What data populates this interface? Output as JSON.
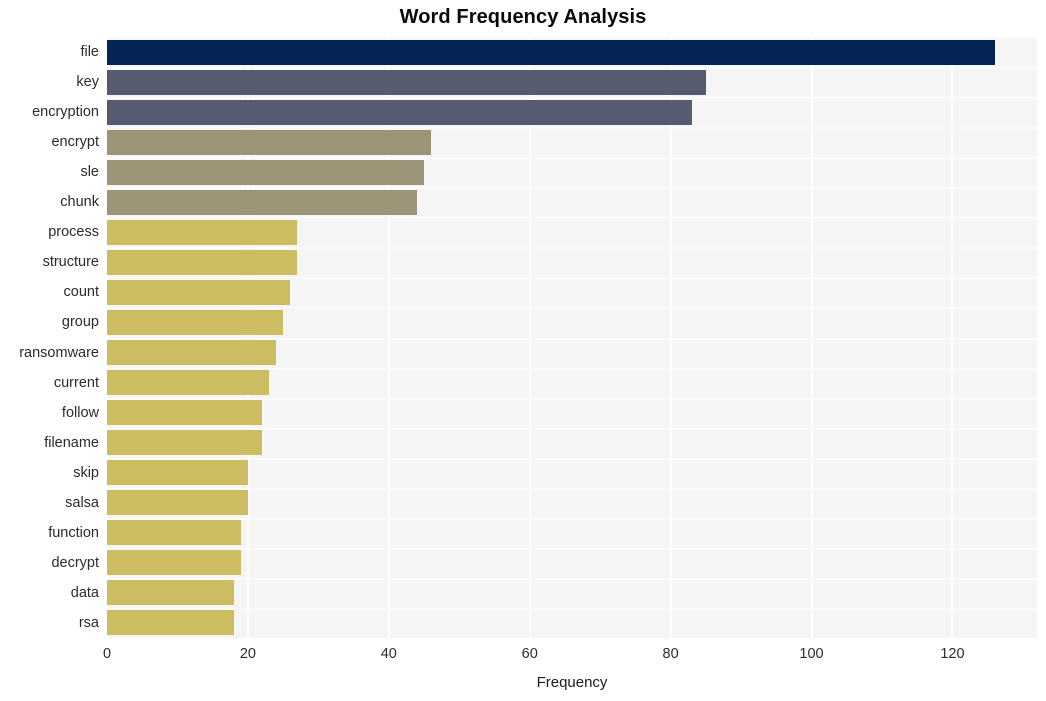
{
  "chart_data": {
    "type": "bar",
    "orientation": "horizontal",
    "title": "Word Frequency Analysis",
    "xlabel": "Frequency",
    "ylabel": "",
    "categories": [
      "file",
      "key",
      "encryption",
      "encrypt",
      "sle",
      "chunk",
      "process",
      "structure",
      "count",
      "group",
      "ransomware",
      "current",
      "follow",
      "filename",
      "skip",
      "salsa",
      "function",
      "decrypt",
      "data",
      "rsa"
    ],
    "values": [
      126,
      85,
      83,
      46,
      45,
      44,
      27,
      27,
      26,
      25,
      24,
      23,
      22,
      22,
      20,
      20,
      19,
      19,
      18,
      18
    ],
    "bar_colors": [
      "#042554",
      "#565b71",
      "#565b71",
      "#9c9476",
      "#9c9476",
      "#9c9476",
      "#ccbd62",
      "#ccbd62",
      "#ccbd62",
      "#ccbd62",
      "#ccbd62",
      "#ccbd62",
      "#ccbd62",
      "#ccbd62",
      "#ccbd62",
      "#ccbd62",
      "#ccbd62",
      "#ccbd62",
      "#ccbd62",
      "#ccbd62"
    ],
    "xlim": [
      0,
      132
    ],
    "xticks": [
      0,
      20,
      40,
      60,
      80,
      100,
      120
    ],
    "xtick_labels": [
      "0",
      "20",
      "40",
      "60",
      "80",
      "100",
      "120"
    ],
    "grid": true,
    "grid_color": "#ffffff",
    "plot_background": "#f5f5f5",
    "figure_background": "#ffffff",
    "legend": null
  }
}
